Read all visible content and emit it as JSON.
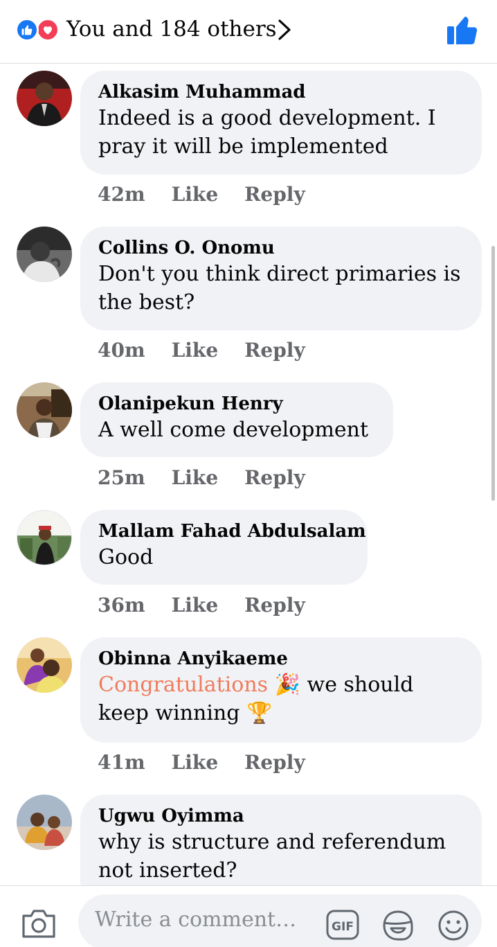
{
  "header": {
    "reactions_summary": "You and 184 others",
    "reaction_icons": [
      "like-reaction-icon",
      "love-reaction-icon"
    ]
  },
  "comments": [
    {
      "name": "Alkasim Muhammad",
      "text": "Indeed is a good development. I pray it will be implemented",
      "time": "42m",
      "like": "Like",
      "reply": "Reply"
    },
    {
      "name": "Collins O. Onomu",
      "text": "Don't you think direct primaries is the best?",
      "time": "40m",
      "like": "Like",
      "reply": "Reply"
    },
    {
      "name": "Olanipekun Henry",
      "text": "A well come development",
      "time": "25m",
      "like": "Like",
      "reply": "Reply"
    },
    {
      "name": "Mallam Fahad Abdulsalam",
      "text": "Good",
      "time": "36m",
      "like": "Like",
      "reply": "Reply"
    },
    {
      "name": "Obinna Anyikaeme",
      "text_highlight": "Congratulations",
      "emoji_party": "🎉",
      "text_middle": "we should keep winning",
      "emoji_trophy": "🏆",
      "time": "41m",
      "like": "Like",
      "reply": "Reply"
    },
    {
      "name": "Ugwu Oyimma",
      "text": "why is structure and referendum not inserted?"
    }
  ],
  "composer": {
    "placeholder": "Write a comment…",
    "gif_label": "GIF"
  },
  "colors": {
    "accent": "#1877f2",
    "love": "#f33e58",
    "highlight": "#f07b5c",
    "bubble": "#f0f2f5",
    "meta": "#65676b"
  }
}
